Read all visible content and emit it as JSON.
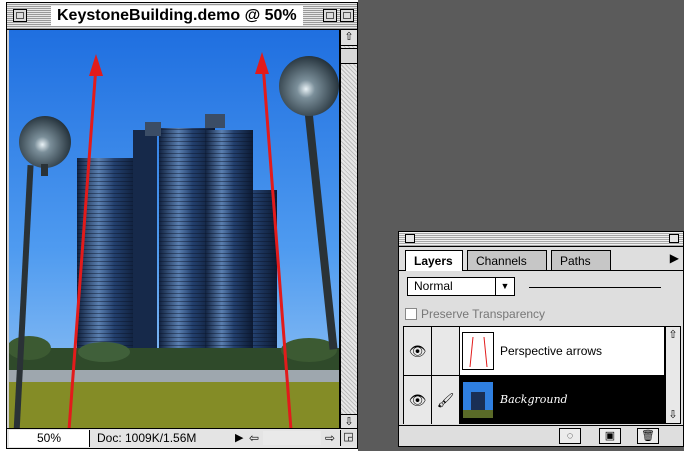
{
  "document_window": {
    "title": "KeystoneBuilding.demo @ 50%",
    "zoom": "50%",
    "doc_info": "Doc: 1009K/1.56M",
    "icons": {
      "close_box": "close-box-icon",
      "zoom_box": "zoom-box-icon",
      "scroll_up": "arrow-up-icon",
      "scroll_down": "arrow-down-icon",
      "scroll_left": "arrow-left-icon",
      "scroll_right": "arrow-right-icon",
      "grow": "resize-icon"
    }
  },
  "layers_palette": {
    "tabs": [
      {
        "label": "Layers",
        "active": true
      },
      {
        "label": "Channels",
        "active": false
      },
      {
        "label": "Paths",
        "active": false
      }
    ],
    "blend_mode": "Normal",
    "preserve_transparency_label": "Preserve Transparency",
    "preserve_transparency_checked": false,
    "layers": [
      {
        "name": "Perspective arrows",
        "visible": true,
        "selected": false
      },
      {
        "name": "Background",
        "visible": true,
        "selected": true
      }
    ],
    "bottom_buttons": [
      "mask-icon",
      "new-layer-icon",
      "trash-icon"
    ]
  },
  "colors": {
    "desktop": "#5b5b5b",
    "arrow": "#e21b1b",
    "sky": "#2f7fe0"
  }
}
